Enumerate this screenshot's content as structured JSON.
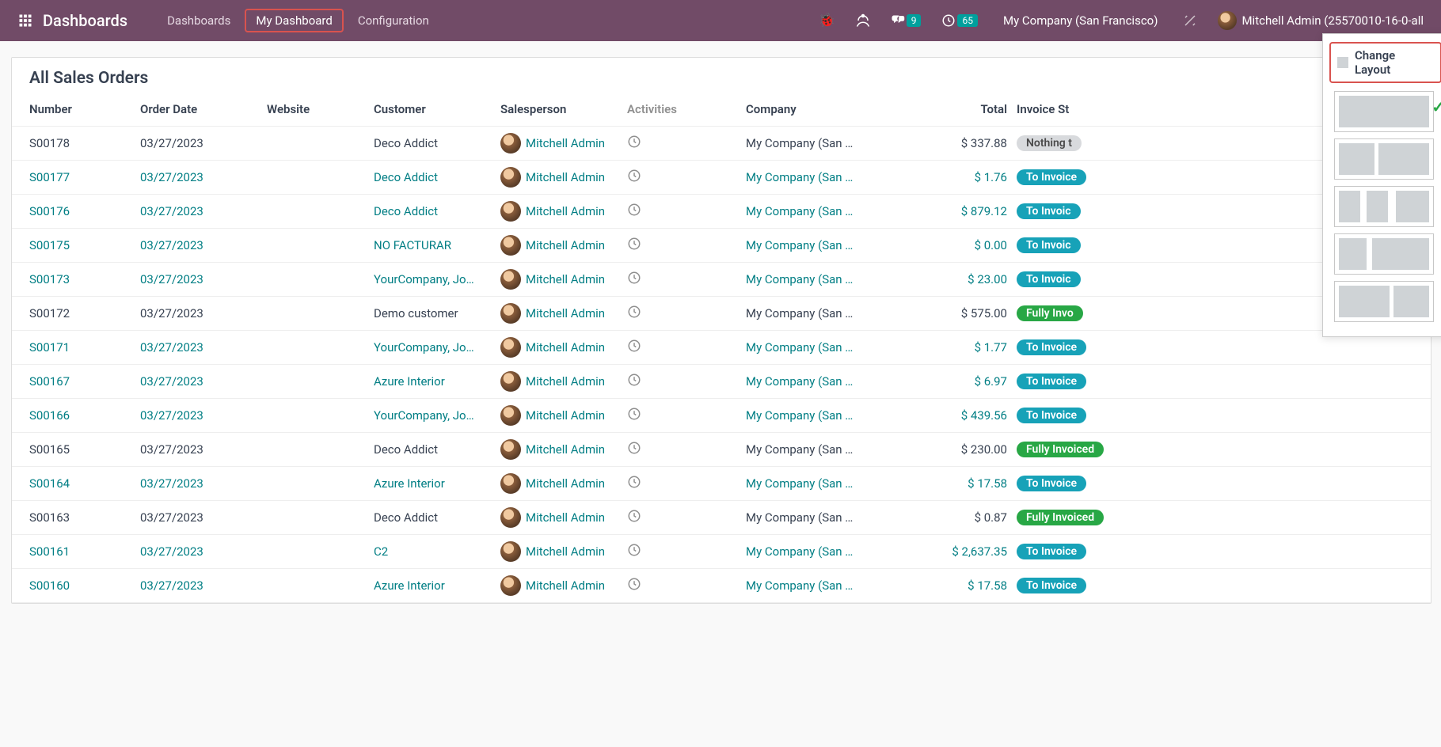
{
  "topbar": {
    "title": "Dashboards",
    "nav": [
      {
        "label": "Dashboards",
        "active": false,
        "highlight": false
      },
      {
        "label": "My Dashboard",
        "active": true,
        "highlight": true
      },
      {
        "label": "Configuration",
        "active": false,
        "highlight": false
      }
    ],
    "badges": {
      "messages": "9",
      "activities": "65"
    },
    "company": "My Company (San Francisco)",
    "user": "Mitchell Admin (25570010-16-0-all"
  },
  "panel": {
    "change_layout": "Change Layout",
    "layouts": [
      {
        "kind": "l1",
        "selected": true
      },
      {
        "kind": "l2",
        "selected": false
      },
      {
        "kind": "l3",
        "selected": false
      },
      {
        "kind": "l4",
        "selected": false
      },
      {
        "kind": "l5",
        "selected": false
      }
    ]
  },
  "card": {
    "title": "All Sales Orders",
    "headers": {
      "number": "Number",
      "date": "Order Date",
      "website": "Website",
      "customer": "Customer",
      "salesperson": "Salesperson",
      "activities": "Activities",
      "company": "Company",
      "total": "Total",
      "invoice": "Invoice St"
    },
    "rows": [
      {
        "num": "S00178",
        "date": "03/27/2023",
        "cust": "Deco Addict",
        "sp": "Mitchell Admin",
        "comp": "My Company (San …",
        "total": "$ 337.88",
        "inv": "Nothing t",
        "pill": "nothing",
        "link": false
      },
      {
        "num": "S00177",
        "date": "03/27/2023",
        "cust": "Deco Addict",
        "sp": "Mitchell Admin",
        "comp": "My Company (San …",
        "total": "$ 1.76",
        "inv": "To Invoice",
        "pill": "toinvoice",
        "link": true
      },
      {
        "num": "S00176",
        "date": "03/27/2023",
        "cust": "Deco Addict",
        "sp": "Mitchell Admin",
        "comp": "My Company (San …",
        "total": "$ 879.12",
        "inv": "To Invoic",
        "pill": "toinvoice",
        "link": true
      },
      {
        "num": "S00175",
        "date": "03/27/2023",
        "cust": "NO FACTURAR",
        "sp": "Mitchell Admin",
        "comp": "My Company (San …",
        "total": "$ 0.00",
        "inv": "To Invoic",
        "pill": "toinvoice",
        "link": true
      },
      {
        "num": "S00173",
        "date": "03/27/2023",
        "cust": "YourCompany, Jo…",
        "sp": "Mitchell Admin",
        "comp": "My Company (San …",
        "total": "$ 23.00",
        "inv": "To Invoic",
        "pill": "toinvoice",
        "link": true
      },
      {
        "num": "S00172",
        "date": "03/27/2023",
        "cust": "Demo customer",
        "sp": "Mitchell Admin",
        "comp": "My Company (San …",
        "total": "$ 575.00",
        "inv": "Fully Invo",
        "pill": "fully",
        "link": false
      },
      {
        "num": "S00171",
        "date": "03/27/2023",
        "cust": "YourCompany, Jo…",
        "sp": "Mitchell Admin",
        "comp": "My Company (San …",
        "total": "$ 1.77",
        "inv": "To Invoice",
        "pill": "toinvoice",
        "link": true
      },
      {
        "num": "S00167",
        "date": "03/27/2023",
        "cust": "Azure Interior",
        "sp": "Mitchell Admin",
        "comp": "My Company (San …",
        "total": "$ 6.97",
        "inv": "To Invoice",
        "pill": "toinvoice",
        "link": true
      },
      {
        "num": "S00166",
        "date": "03/27/2023",
        "cust": "YourCompany, Jo…",
        "sp": "Mitchell Admin",
        "comp": "My Company (San …",
        "total": "$ 439.56",
        "inv": "To Invoice",
        "pill": "toinvoice",
        "link": true
      },
      {
        "num": "S00165",
        "date": "03/27/2023",
        "cust": "Deco Addict",
        "sp": "Mitchell Admin",
        "comp": "My Company (San …",
        "total": "$ 230.00",
        "inv": "Fully Invoiced",
        "pill": "fully",
        "link": false
      },
      {
        "num": "S00164",
        "date": "03/27/2023",
        "cust": "Azure Interior",
        "sp": "Mitchell Admin",
        "comp": "My Company (San …",
        "total": "$ 17.58",
        "inv": "To Invoice",
        "pill": "toinvoice",
        "link": true
      },
      {
        "num": "S00163",
        "date": "03/27/2023",
        "cust": "Deco Addict",
        "sp": "Mitchell Admin",
        "comp": "My Company (San …",
        "total": "$ 0.87",
        "inv": "Fully Invoiced",
        "pill": "fully",
        "link": false
      },
      {
        "num": "S00161",
        "date": "03/27/2023",
        "cust": "C2",
        "sp": "Mitchell Admin",
        "comp": "My Company (San …",
        "total": "$ 2,637.35",
        "inv": "To Invoice",
        "pill": "toinvoice",
        "link": true
      },
      {
        "num": "S00160",
        "date": "03/27/2023",
        "cust": "Azure Interior",
        "sp": "Mitchell Admin",
        "comp": "My Company (San …",
        "total": "$ 17.58",
        "inv": "To Invoice",
        "pill": "toinvoice",
        "link": true
      }
    ]
  }
}
